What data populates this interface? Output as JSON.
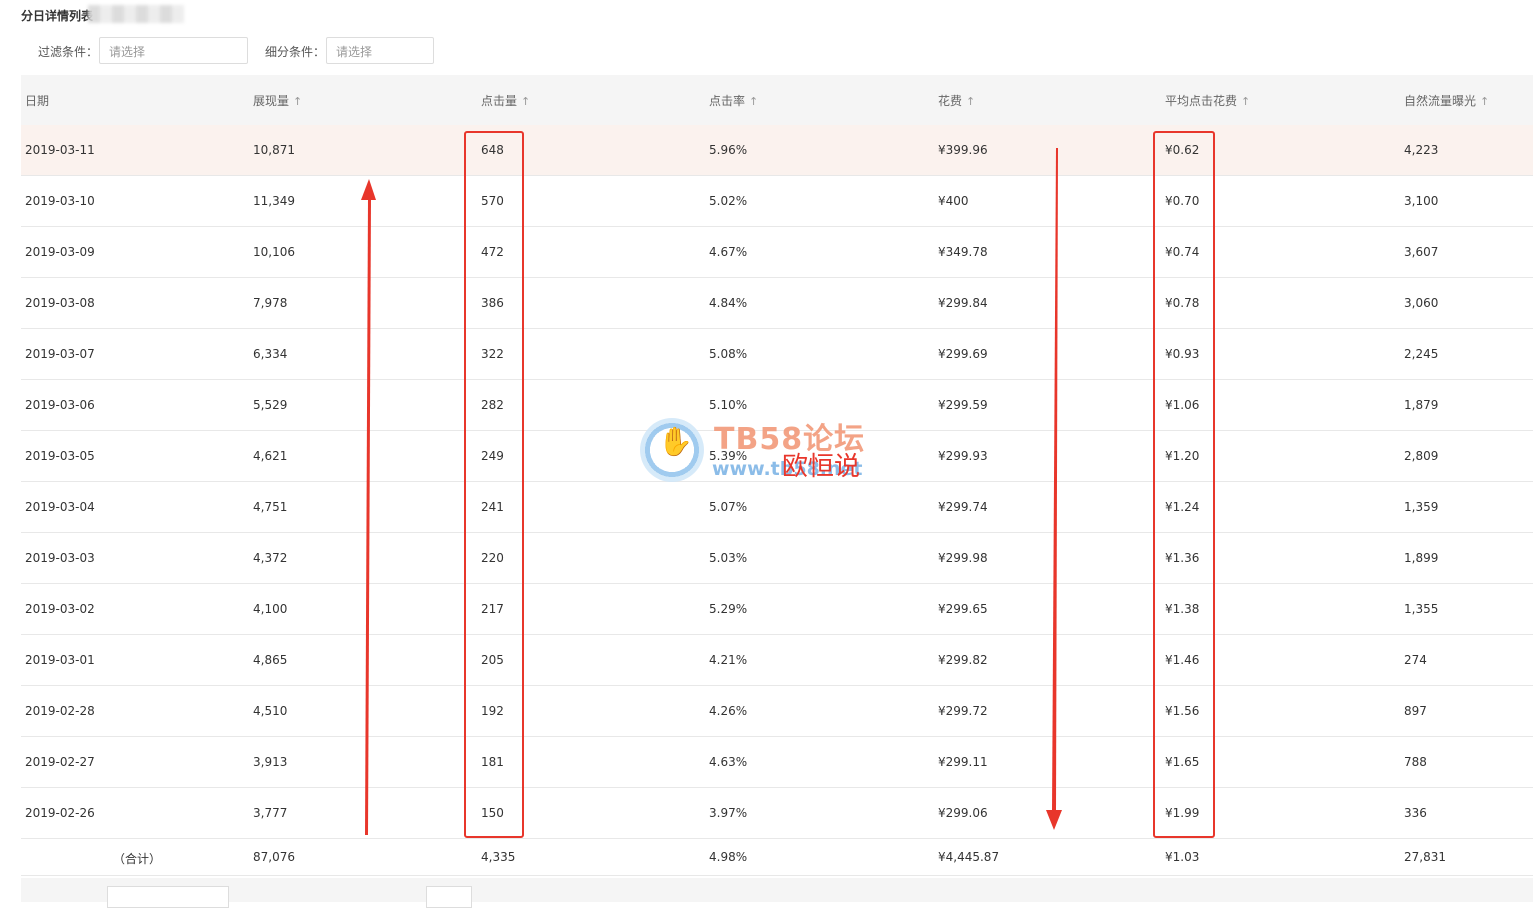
{
  "header": {
    "title": "分日详情列表"
  },
  "filters": {
    "filter_label": "过滤条件：",
    "filter_placeholder": "请选择",
    "segment_label": "细分条件：",
    "segment_placeholder": "请选择"
  },
  "table": {
    "columns": [
      {
        "label": "日期",
        "sortable": false
      },
      {
        "label": "展现量",
        "sortable": true
      },
      {
        "label": "点击量",
        "sortable": true
      },
      {
        "label": "点击率",
        "sortable": true
      },
      {
        "label": "花费",
        "sortable": true
      },
      {
        "label": "平均点击花费",
        "sortable": true
      },
      {
        "label": "自然流量曝光",
        "sortable": true
      }
    ],
    "sort_icon": "↑",
    "rows": [
      [
        "2019-03-11",
        "10,871",
        "648",
        "5.96%",
        "¥399.96",
        "¥0.62",
        "4,223"
      ],
      [
        "2019-03-10",
        "11,349",
        "570",
        "5.02%",
        "¥400",
        "¥0.70",
        "3,100"
      ],
      [
        "2019-03-09",
        "10,106",
        "472",
        "4.67%",
        "¥349.78",
        "¥0.74",
        "3,607"
      ],
      [
        "2019-03-08",
        "7,978",
        "386",
        "4.84%",
        "¥299.84",
        "¥0.78",
        "3,060"
      ],
      [
        "2019-03-07",
        "6,334",
        "322",
        "5.08%",
        "¥299.69",
        "¥0.93",
        "2,245"
      ],
      [
        "2019-03-06",
        "5,529",
        "282",
        "5.10%",
        "¥299.59",
        "¥1.06",
        "1,879"
      ],
      [
        "2019-03-05",
        "4,621",
        "249",
        "5.39%",
        "¥299.93",
        "¥1.20",
        "2,809"
      ],
      [
        "2019-03-04",
        "4,751",
        "241",
        "5.07%",
        "¥299.74",
        "¥1.24",
        "1,359"
      ],
      [
        "2019-03-03",
        "4,372",
        "220",
        "5.03%",
        "¥299.98",
        "¥1.36",
        "1,899"
      ],
      [
        "2019-03-02",
        "4,100",
        "217",
        "5.29%",
        "¥299.65",
        "¥1.38",
        "1,355"
      ],
      [
        "2019-03-01",
        "4,865",
        "205",
        "4.21%",
        "¥299.82",
        "¥1.46",
        "274"
      ],
      [
        "2019-02-28",
        "4,510",
        "192",
        "4.26%",
        "¥299.72",
        "¥1.56",
        "897"
      ],
      [
        "2019-02-27",
        "3,913",
        "181",
        "4.63%",
        "¥299.11",
        "¥1.65",
        "788"
      ],
      [
        "2019-02-26",
        "3,777",
        "150",
        "3.97%",
        "¥299.06",
        "¥1.99",
        "336"
      ]
    ],
    "total": [
      "（合计）",
      "87,076",
      "4,335",
      "4.98%",
      "¥4,445.87",
      "¥1.03",
      "27,831"
    ]
  },
  "watermark": {
    "brand": "TB58论坛",
    "url": "www.tb58.net",
    "author": "欧恒说",
    "logo_icon": "hand-icon"
  },
  "colors": {
    "annotation": "#e8362b",
    "highlight_row": "#fbf2ee",
    "header_bg": "#f5f5f5"
  }
}
